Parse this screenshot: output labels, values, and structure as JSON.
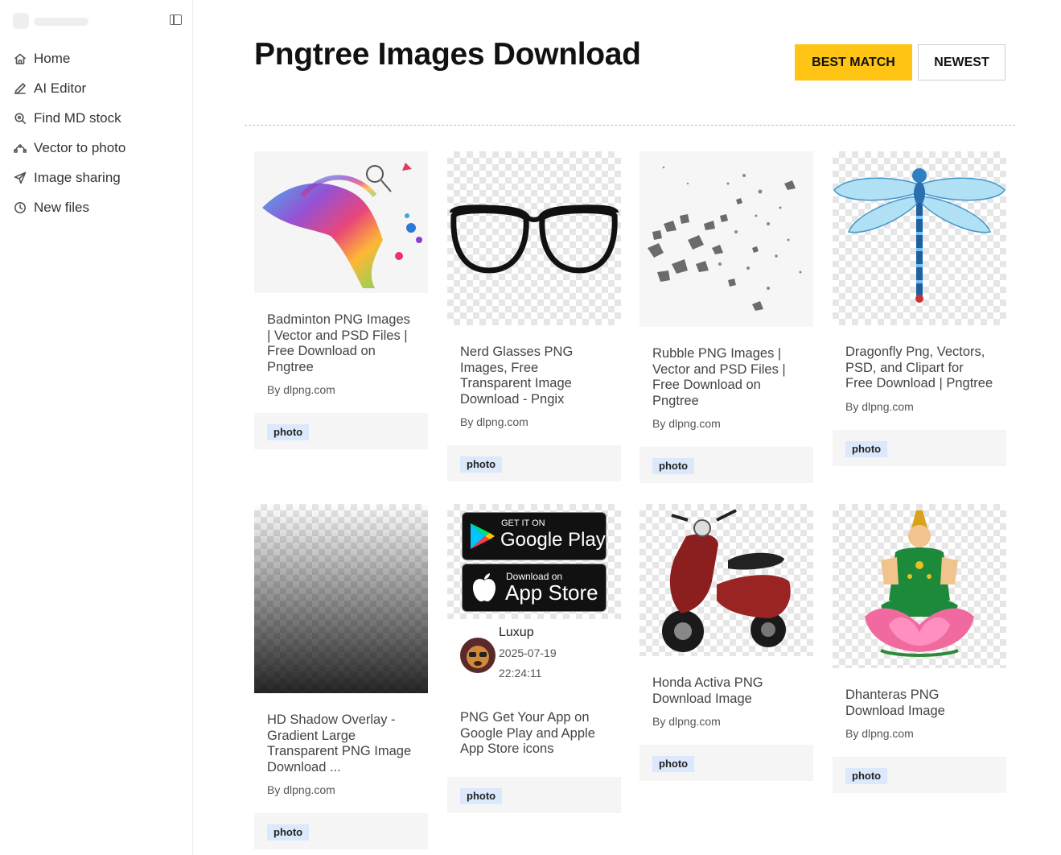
{
  "sidebar": {
    "items": [
      {
        "label": "Home",
        "icon": "home-icon"
      },
      {
        "label": "AI Editor",
        "icon": "pen-icon"
      },
      {
        "label": "Find MD stock",
        "icon": "search-icon"
      },
      {
        "label": "Vector to photo",
        "icon": "vector-icon"
      },
      {
        "label": "Image sharing",
        "icon": "send-icon"
      },
      {
        "label": "New files",
        "icon": "clock-icon"
      }
    ]
  },
  "header": {
    "title": "Pngtree Images Download",
    "sort": {
      "best_match": "BEST MATCH",
      "newest": "NEWEST"
    }
  },
  "colors": {
    "accent": "#ffc414",
    "tag_bg": "#dce8fb",
    "footer_bg": "#f5f5f5"
  },
  "cards": [
    {
      "title": "Badminton PNG Images | Vector and PSD Files | Free Download on Pngtree",
      "by": "By dlpng.com",
      "tag": "photo"
    },
    {
      "title": "Nerd Glasses PNG Images, Free Transparent Image Download - Pngix",
      "by": "By dlpng.com",
      "tag": "photo"
    },
    {
      "title": "Rubble PNG Images | Vector and PSD Files | Free Download on Pngtree",
      "by": "By dlpng.com",
      "tag": "photo"
    },
    {
      "title": "Dragonfly Png, Vectors, PSD, and Clipart for Free Download | Pngtree",
      "by": "By dlpng.com",
      "tag": "photo"
    },
    {
      "title": "HD Shadow Overlay - Gradient Large Transparent PNG Image Download ...",
      "by": "By dlpng.com",
      "tag": "photo"
    },
    {
      "title": "PNG Get Your App on Google Play and Apple App Store icons",
      "tag": "photo",
      "author": {
        "name": "Luxup",
        "date": "2025-07-19",
        "time": "22:24:11"
      },
      "badges": {
        "google_small": "GET IT ON",
        "google_big": "Google Play",
        "apple_small": "Download on",
        "apple_big": "App Store"
      }
    },
    {
      "title": "Honda Activa PNG Download Image",
      "by": "By dlpng.com",
      "tag": "photo"
    },
    {
      "title": "Dhanteras PNG Download Image",
      "by": "By dlpng.com",
      "tag": "photo"
    }
  ]
}
